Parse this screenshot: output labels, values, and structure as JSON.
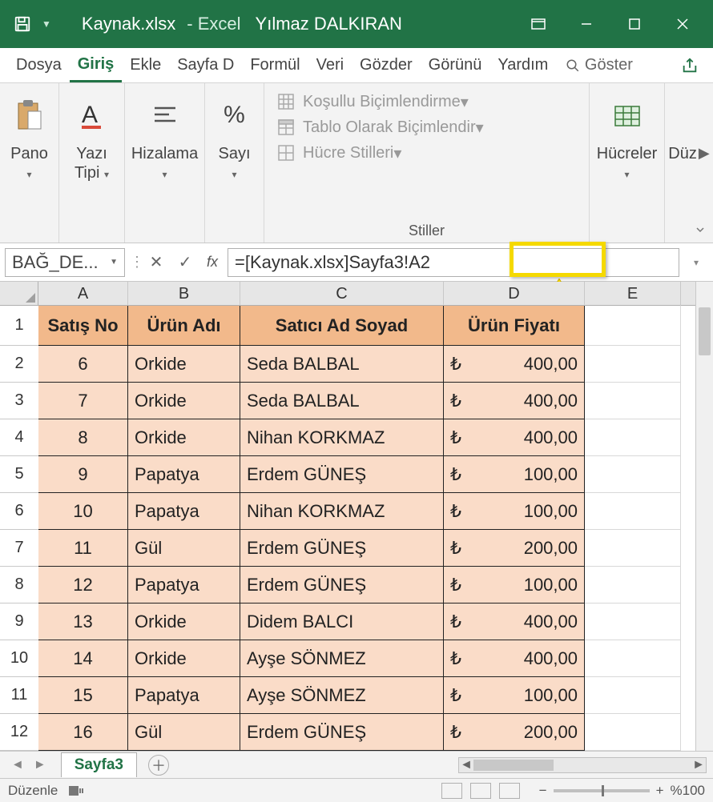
{
  "titlebar": {
    "filename": "Kaynak.xlsx",
    "appname": "Excel",
    "username": "Yılmaz DALKIRAN"
  },
  "tabs": {
    "items": [
      "Dosya",
      "Giriş",
      "Ekle",
      "Sayfa D",
      "Formül",
      "Veri",
      "Gözder",
      "Görünü",
      "Yardım"
    ],
    "active_index": 1,
    "search_label": "Göster"
  },
  "ribbon": {
    "groups": {
      "clipboard": "Pano",
      "font": "Yazı Tipi",
      "alignment": "Hizalama",
      "number": "Sayı",
      "styles_label": "Stiller",
      "styles_items": [
        "Koşullu Biçimlendirme",
        "Tablo Olarak Biçimlendir",
        "Hücre Stilleri"
      ],
      "cells": "Hücreler",
      "editing": "Düz"
    }
  },
  "formula_bar": {
    "name_box": "BAĞ_DE...",
    "formula": "=[Kaynak.xlsx]Sayfa3!A2"
  },
  "columns": [
    "A",
    "B",
    "C",
    "D",
    "E"
  ],
  "row_numbers": [
    "1",
    "2",
    "3",
    "4",
    "5",
    "6",
    "7",
    "8",
    "9",
    "10",
    "11",
    "12"
  ],
  "table": {
    "headers": [
      "Satış No",
      "Ürün Adı",
      "Satıcı Ad Soyad",
      "Ürün Fiyatı"
    ],
    "currency": "₺",
    "rows": [
      {
        "no": "6",
        "urun": "Orkide",
        "satici": "Seda BALBAL",
        "fiyat": "400,00"
      },
      {
        "no": "7",
        "urun": "Orkide",
        "satici": "Seda BALBAL",
        "fiyat": "400,00"
      },
      {
        "no": "8",
        "urun": "Orkide",
        "satici": "Nihan KORKMAZ",
        "fiyat": "400,00"
      },
      {
        "no": "9",
        "urun": "Papatya",
        "satici": "Erdem GÜNEŞ",
        "fiyat": "100,00"
      },
      {
        "no": "10",
        "urun": "Papatya",
        "satici": "Nihan KORKMAZ",
        "fiyat": "100,00"
      },
      {
        "no": "11",
        "urun": "Gül",
        "satici": "Erdem GÜNEŞ",
        "fiyat": "200,00"
      },
      {
        "no": "12",
        "urun": "Papatya",
        "satici": "Erdem GÜNEŞ",
        "fiyat": "100,00"
      },
      {
        "no": "13",
        "urun": "Orkide",
        "satici": "Didem BALCI",
        "fiyat": "400,00"
      },
      {
        "no": "14",
        "urun": "Orkide",
        "satici": "Ayşe SÖNMEZ",
        "fiyat": "400,00"
      },
      {
        "no": "15",
        "urun": "Papatya",
        "satici": "Ayşe SÖNMEZ",
        "fiyat": "100,00"
      },
      {
        "no": "16",
        "urun": "Gül",
        "satici": "Erdem GÜNEŞ",
        "fiyat": "200,00"
      }
    ]
  },
  "sheet_tabs": {
    "active": "Sayfa3"
  },
  "status": {
    "mode": "Düzenle",
    "zoom": "%100"
  }
}
